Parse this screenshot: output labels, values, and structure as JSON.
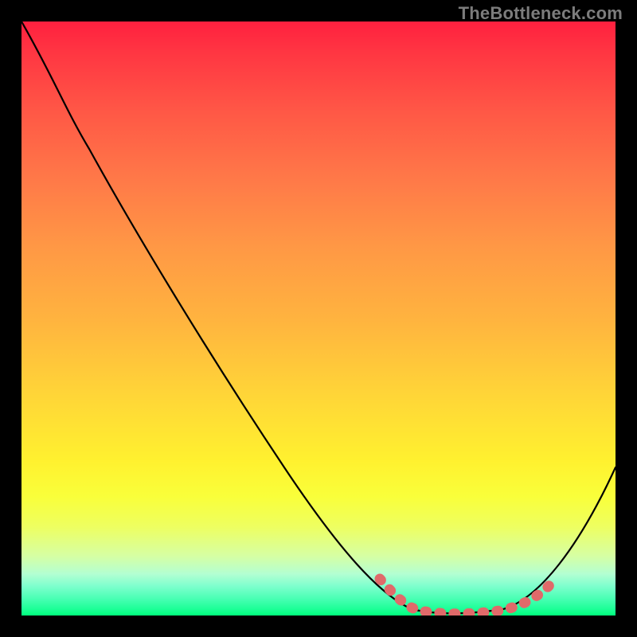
{
  "watermark": "TheBottleneck.com",
  "chart_data": {
    "type": "line",
    "title": "",
    "xlabel": "",
    "ylabel": "",
    "xlim": [
      0,
      100
    ],
    "ylim": [
      0,
      100
    ],
    "series": [
      {
        "name": "bottleneck-curve",
        "x": [
          0,
          5,
          10,
          15,
          20,
          25,
          30,
          35,
          40,
          45,
          50,
          55,
          60,
          65,
          70,
          75,
          78,
          82,
          86,
          90,
          94,
          100
        ],
        "values": [
          100,
          92,
          85,
          78,
          70,
          62,
          54,
          46,
          38,
          30,
          22,
          15,
          10,
          6,
          3,
          1,
          0,
          0,
          1,
          4,
          10,
          25
        ]
      },
      {
        "name": "valley-marker",
        "x": [
          60,
          63,
          66,
          69,
          72,
          75,
          78,
          81,
          84,
          87,
          90
        ],
        "values": [
          6,
          4,
          3,
          2,
          1,
          1,
          0,
          0,
          1,
          2,
          5
        ]
      }
    ],
    "background_gradient": {
      "type": "vertical",
      "stops": [
        {
          "pos": 0.0,
          "color": "#ff203f"
        },
        {
          "pos": 0.27,
          "color": "#ff7a48"
        },
        {
          "pos": 0.5,
          "color": "#ffb33f"
        },
        {
          "pos": 0.74,
          "color": "#fff12f"
        },
        {
          "pos": 0.9,
          "color": "#d6ffa4"
        },
        {
          "pos": 1.0,
          "color": "#00ff7c"
        }
      ]
    },
    "annotations": [
      {
        "text": "TheBottleneck.com",
        "position": "top-right",
        "color": "#7c7c7c"
      }
    ]
  },
  "colors": {
    "curve": "#000000",
    "valley_marker": "#e06a6a",
    "frame": "#000000",
    "watermark": "#7c7c7c"
  }
}
